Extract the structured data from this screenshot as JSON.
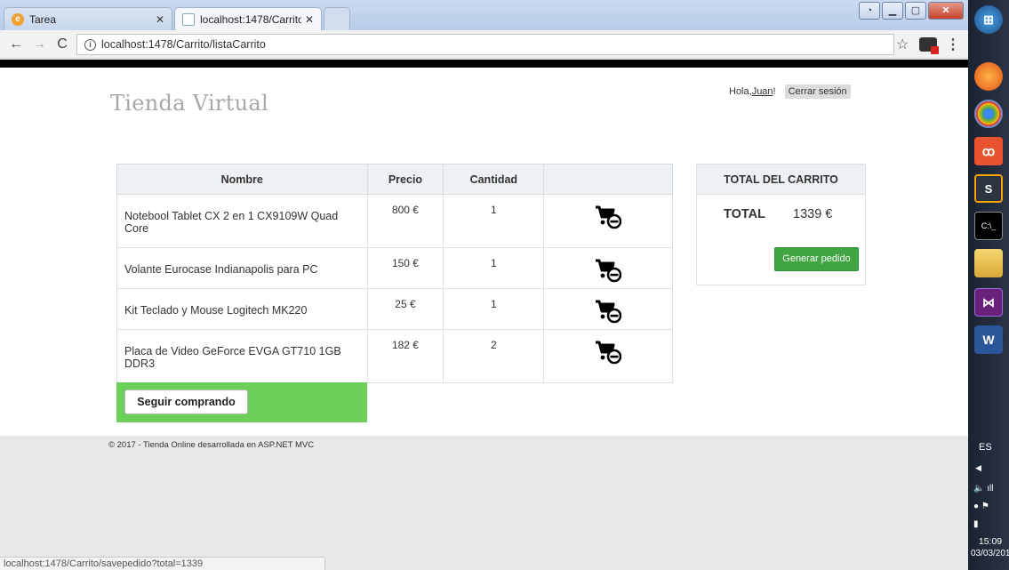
{
  "browser": {
    "tabs": [
      {
        "label": "Tarea",
        "active": false
      },
      {
        "label": "localhost:1478/Carrito/lis",
        "active": true
      }
    ],
    "url": "localhost:1478/Carrito/listaCarrito",
    "status_url": "localhost:1478/Carrito/savepedido?total=1339"
  },
  "site": {
    "brand": "Tienda Virtual",
    "greeting_prefix": "Hola, ",
    "user_name": "Juan",
    "greeting_suffix": "!",
    "logout_label": "Cerrar sesión"
  },
  "cart": {
    "headers": {
      "name": "Nombre",
      "price": "Precio",
      "qty": "Cantidad"
    },
    "items": [
      {
        "name": "Notebool Tablet CX 2 en 1 CX9109W Quad Core",
        "price": "800 €",
        "qty": "1"
      },
      {
        "name": "Volante Eurocase Indianapolis para PC",
        "price": "150 €",
        "qty": "1"
      },
      {
        "name": "Kit Teclado y Mouse Logitech MK220",
        "price": "25 €",
        "qty": "1"
      },
      {
        "name": "Placa de Video GeForce EVGA GT710 1GB DDR3",
        "price": "182 €",
        "qty": "2"
      }
    ],
    "continue_label": "Seguir comprando"
  },
  "total_panel": {
    "title": "TOTAL DEL CARRITO",
    "total_label": "TOTAL",
    "total_value": "1339 €",
    "order_label": "Generar pedido"
  },
  "footer": {
    "text": "© 2017 - Tienda Online desarrollada en ASP.NET MVC"
  },
  "taskbar": {
    "lang": "ES",
    "time": "15:09",
    "date": "03/03/201"
  },
  "colors": {
    "accent_green": "#3fa441",
    "panel_green": "#6ccf5a",
    "header_gray": "#eef1f4"
  }
}
